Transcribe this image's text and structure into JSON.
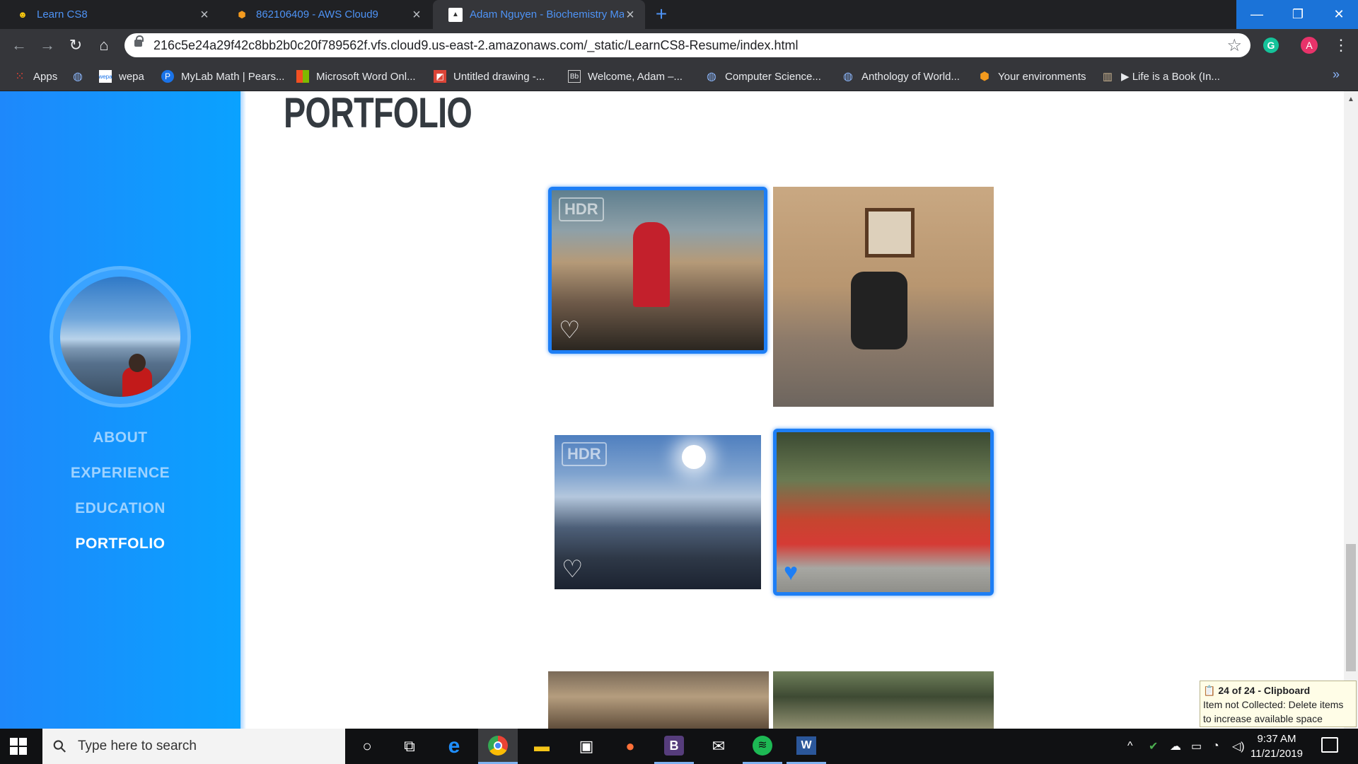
{
  "browser": {
    "tabs": [
      {
        "title": "Learn CS8",
        "icon": "cs8-logo-icon",
        "active": false
      },
      {
        "title": "862106409 - AWS Cloud9",
        "icon": "aws-cloud9-icon",
        "active": false
      },
      {
        "title": "Adam Nguyen - Biochemistry Ma",
        "icon": "page-icon",
        "active": true
      }
    ],
    "new_tab": "+",
    "window_controls": {
      "minimize": "—",
      "restore": "❐",
      "close": "✕"
    },
    "address": "216c5e24a29f42c8bb2b0c20f789562f.vfs.cloud9.us-east-2.amazonaws.com/_static/LearnCS8-Resume/index.html",
    "profile_initial": "A",
    "extension_initial": "G",
    "bookmarks": [
      {
        "label": "Apps",
        "icon": "apps-grid-icon"
      },
      {
        "label": "",
        "icon": "globe-icon"
      },
      {
        "label": "wepa",
        "icon": "wepa-icon"
      },
      {
        "label": "MyLab Math | Pears...",
        "icon": "pearson-icon"
      },
      {
        "label": "Microsoft Word Onl...",
        "icon": "microsoft-icon"
      },
      {
        "label": "Untitled drawing -...",
        "icon": "drawing-icon"
      },
      {
        "label": "Welcome, Adam –...",
        "icon": "blackboard-icon"
      },
      {
        "label": "Computer Science...",
        "icon": "globe-icon"
      },
      {
        "label": "Anthology of World...",
        "icon": "globe-icon"
      },
      {
        "label": "Your environments",
        "icon": "aws-cloud9-icon"
      },
      {
        "label": "▶ Life is a Book (In...",
        "icon": "book-icon"
      }
    ],
    "bookmarks_more": "»"
  },
  "page": {
    "nav": [
      {
        "label": "ABOUT",
        "active": false
      },
      {
        "label": "EXPERIENCE",
        "active": false
      },
      {
        "label": "EDUCATION",
        "active": false
      },
      {
        "label": "PORTFOLIO",
        "active": true
      }
    ],
    "section_title": "PORTFOLIO",
    "photos": [
      {
        "name": "photo-group-outdoors",
        "hdr": "HDR",
        "selected": true
      },
      {
        "name": "photo-office-room",
        "hdr": "",
        "selected": false
      },
      {
        "name": "photo-mountain-sunset",
        "hdr": "HDR",
        "selected": false
      },
      {
        "name": "photo-group-red-shirts",
        "hdr": "",
        "selected": true
      },
      {
        "name": "photo-indoor-ceiling",
        "hdr": "",
        "selected": false
      },
      {
        "name": "photo-forest",
        "hdr": "",
        "selected": false
      }
    ]
  },
  "clipboard_toast": {
    "title": "24 of 24 - Clipboard",
    "message": "Item not Collected: Delete items to increase available space"
  },
  "taskbar": {
    "search_placeholder": "Type here to search",
    "time": "9:37 AM",
    "date": "11/21/2019",
    "apps": [
      "cortana-icon",
      "task-view-icon",
      "edge-icon",
      "chrome-icon",
      "file-explorer-icon",
      "store-icon",
      "firefox-icon",
      "bootstrap-icon",
      "mail-icon",
      "spotify-icon",
      "word-icon"
    ]
  }
}
